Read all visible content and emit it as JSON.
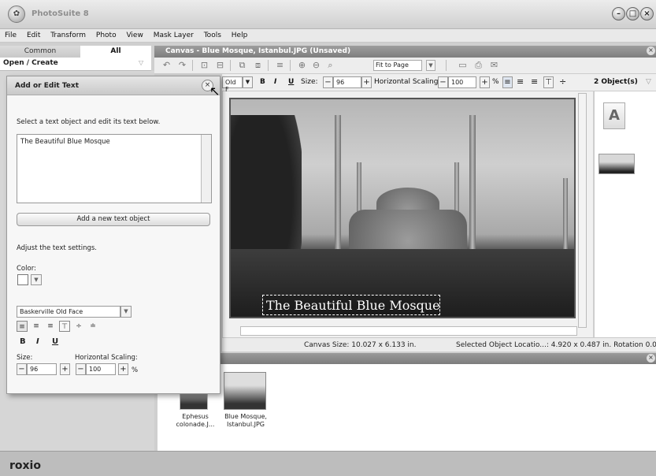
{
  "app": {
    "title": "PhotoSuite 8",
    "logo": "roxio"
  },
  "window_buttons": [
    "minimize",
    "maximize",
    "close"
  ],
  "menu": [
    "File",
    "Edit",
    "Transform",
    "Photo",
    "View",
    "Mask Layer",
    "Tools",
    "Help"
  ],
  "left_tabs": {
    "common": "Common",
    "all": "All"
  },
  "open_create": "Open / Create",
  "canvas": {
    "title": "Canvas - Blue Mosque, Istanbul.JPG (Unsaved)",
    "fit_option": "Fit to Page",
    "size_status": "Canvas Size: 10.027 x 6.133 in.",
    "selection_status": "Selected Object Locatio...: 4.920 x 0.487 in. Rotation 0.00°",
    "caption": "The Beautiful Blue Mosque"
  },
  "text_toolbar": {
    "font_short": "Old F",
    "bold": "B",
    "italic": "I",
    "underline": "U",
    "size_label": "Size:",
    "size_value": "96",
    "hscale_label": "Horizontal Scaling:",
    "hscale_value": "100",
    "percent": "%",
    "minus": "−",
    "plus": "+",
    "objects_count": "2 Object(s)"
  },
  "panel": {
    "title": "Add or Edit Text",
    "instruction": "Select a text object and edit its text below.",
    "text_value": "The Beautiful Blue Mosque",
    "add_button": "Add a new text object",
    "adjust_label": "Adjust the text settings.",
    "color_label": "Color:",
    "font_name": "Baskerville Old Face",
    "bold": "B",
    "italic": "I",
    "underline": "U",
    "size_label": "Size:",
    "size_value": "96",
    "hscale_label": "Horizontal Scaling:",
    "hscale_value": "100",
    "percent": "%",
    "minus": "−",
    "plus": "+"
  },
  "tray": [
    {
      "label": "Ephesus colonade.J..."
    },
    {
      "label": "Blue Mosque, Istanbul.JPG"
    }
  ],
  "right_thumbs": {
    "text_object_glyph": "A"
  }
}
